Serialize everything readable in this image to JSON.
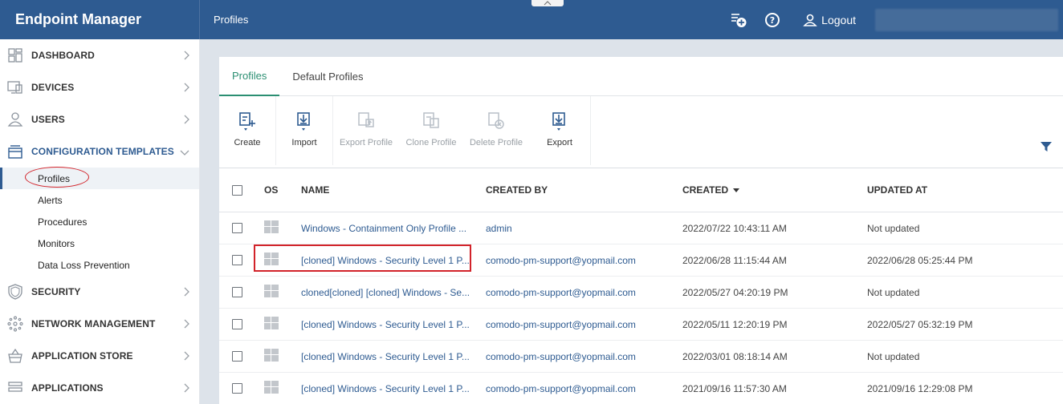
{
  "header": {
    "brand": "Endpoint Manager",
    "page_title": "Profiles",
    "logout_label": "Logout"
  },
  "sidebar": {
    "items": [
      {
        "label": "DASHBOARD",
        "icon": "dashboard-icon"
      },
      {
        "label": "DEVICES",
        "icon": "devices-icon"
      },
      {
        "label": "USERS",
        "icon": "user-icon"
      },
      {
        "label": "CONFIGURATION TEMPLATES",
        "icon": "templates-icon"
      }
    ],
    "sub_items": [
      {
        "label": "Profiles"
      },
      {
        "label": "Alerts"
      },
      {
        "label": "Procedures"
      },
      {
        "label": "Monitors"
      },
      {
        "label": "Data Loss Prevention"
      }
    ],
    "items_after": [
      {
        "label": "SECURITY",
        "icon": "shield-icon"
      },
      {
        "label": "NETWORK MANAGEMENT",
        "icon": "network-icon"
      },
      {
        "label": "APPLICATION STORE",
        "icon": "store-icon"
      },
      {
        "label": "APPLICATIONS",
        "icon": "applications-icon"
      }
    ]
  },
  "tabs": [
    {
      "label": "Profiles"
    },
    {
      "label": "Default Profiles"
    }
  ],
  "toolbar": {
    "create": "Create",
    "import": "Import",
    "export_profile": "Export Profile",
    "clone_profile": "Clone Profile",
    "delete_profile": "Delete Profile",
    "export": "Export"
  },
  "table": {
    "columns": [
      "OS",
      "NAME",
      "CREATED BY",
      "CREATED",
      "UPDATED AT"
    ],
    "rows": [
      {
        "name": "Windows - Containment Only Profile ...",
        "created_by": "admin",
        "created": "2022/07/22 10:43:11 AM",
        "updated_at": "Not updated"
      },
      {
        "name": "[cloned] Windows - Security Level 1 P...",
        "created_by": "comodo-pm-support@yopmail.com",
        "created": "2022/06/28 11:15:44 AM",
        "updated_at": "2022/06/28 05:25:44 PM"
      },
      {
        "name": "cloned[cloned] [cloned] Windows - Se...",
        "created_by": "comodo-pm-support@yopmail.com",
        "created": "2022/05/27 04:20:19 PM",
        "updated_at": "Not updated"
      },
      {
        "name": "[cloned] Windows - Security Level 1 P...",
        "created_by": "comodo-pm-support@yopmail.com",
        "created": "2022/05/11 12:20:19 PM",
        "updated_at": "2022/05/27 05:32:19 PM"
      },
      {
        "name": "[cloned] Windows - Security Level 1 P...",
        "created_by": "comodo-pm-support@yopmail.com",
        "created": "2022/03/01 08:18:14 AM",
        "updated_at": "Not updated"
      },
      {
        "name": "[cloned] Windows - Security Level 1 P...",
        "created_by": "comodo-pm-support@yopmail.com",
        "created": "2021/09/16 11:57:30 AM",
        "updated_at": "2021/09/16 12:29:08 PM"
      }
    ]
  }
}
